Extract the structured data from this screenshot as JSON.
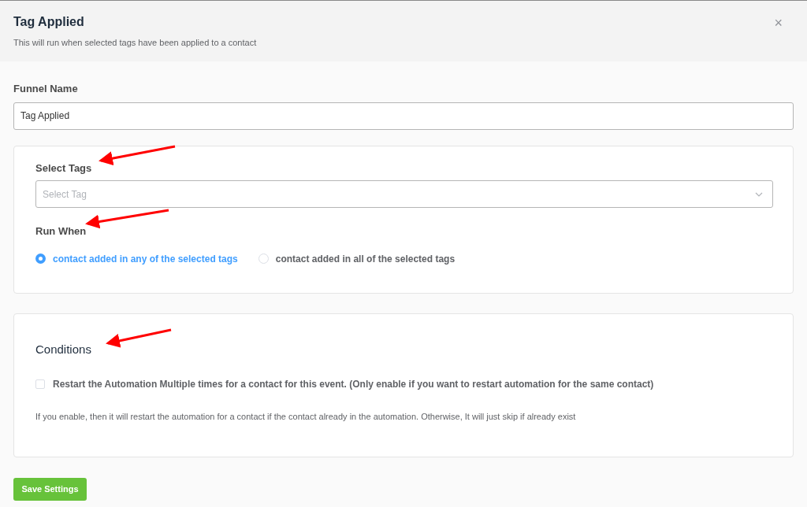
{
  "dialog": {
    "title": "Tag Applied",
    "subtitle": "This will run when selected tags have been applied to a contact",
    "close": "×"
  },
  "funnel_name": {
    "label": "Funnel Name",
    "value": "Tag Applied"
  },
  "select_tags": {
    "label": "Select Tags",
    "placeholder": "Select Tag"
  },
  "run_when": {
    "label": "Run When",
    "options": [
      {
        "label": "contact added in any of the selected tags",
        "selected": true
      },
      {
        "label": "contact added in all of the selected tags",
        "selected": false
      }
    ]
  },
  "conditions": {
    "title": "Conditions",
    "checkbox": {
      "label": "Restart the Automation Multiple times for a contact for this event. (Only enable if you want to restart automation for the same contact)",
      "checked": false
    },
    "help": "If you enable, then it will restart the automation for a contact if the contact already in the automation. Otherwise, It will just skip if already exist"
  },
  "save_button": "Save Settings"
}
